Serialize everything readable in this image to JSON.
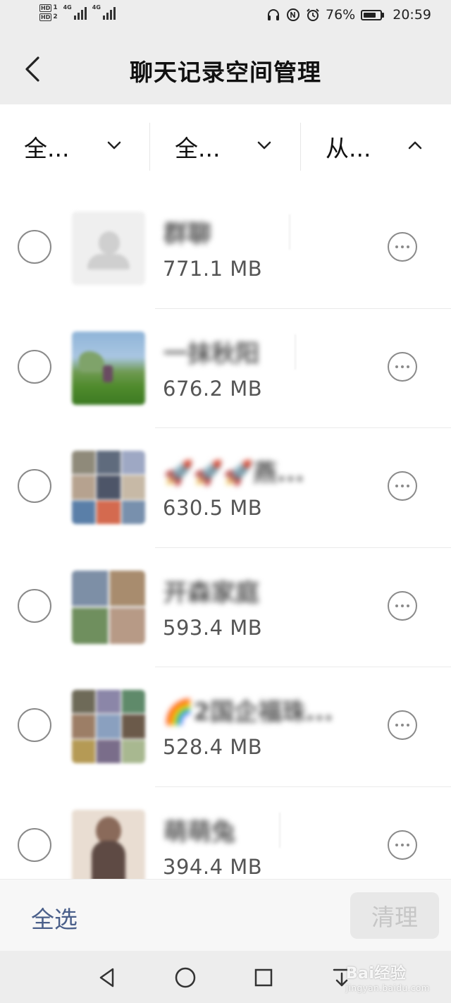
{
  "status_bar": {
    "sim1": "HD",
    "sim1_index": "1",
    "sim2": "HD",
    "sim2_index": "2",
    "network1": "4G",
    "network2": "4G",
    "battery_percent": "76%",
    "battery_level": 0.76,
    "time": "20:59",
    "icons": [
      "headphones-icon",
      "ntc-icon",
      "alarm-icon",
      "battery-icon"
    ]
  },
  "header": {
    "title": "聊天记录空间管理",
    "back_icon": "chevron-left-icon"
  },
  "filters": [
    {
      "label": "全...",
      "icon": "chevron-down-icon"
    },
    {
      "label": "全...",
      "icon": "chevron-down-icon"
    },
    {
      "label": "从...",
      "icon": "chevron-up-icon"
    }
  ],
  "chats": [
    {
      "name": "群聊",
      "size": "771.1 MB"
    },
    {
      "name": "一抹秋阳",
      "size": "676.2 MB"
    },
    {
      "name": "🚀🚀🚀燕...",
      "size": "630.5 MB"
    },
    {
      "name": "开森家庭",
      "size": "593.4 MB"
    },
    {
      "name": "🌈2国企福珠...",
      "size": "528.4 MB"
    },
    {
      "name": "萌萌兔",
      "size": "394.4 MB"
    }
  ],
  "actions": {
    "select_all": "全选",
    "clean": "清理"
  },
  "system_nav": {
    "icons": [
      "back-triangle-icon",
      "home-circle-icon",
      "recents-square-icon",
      "notification-pull-icon"
    ]
  },
  "watermark": {
    "brand": "Bai",
    "brand_suffix": "经验",
    "url": "jingyan.baidu.com"
  }
}
